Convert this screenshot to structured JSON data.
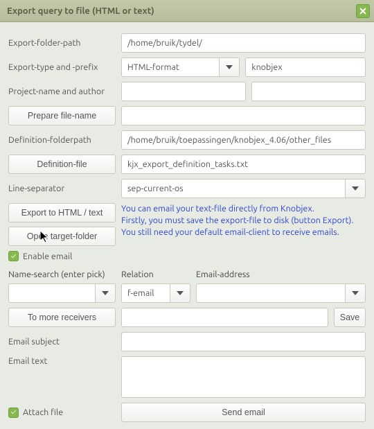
{
  "window": {
    "title": "Export query to file (HTML or text)"
  },
  "labels": {
    "export_folder_path": "Export-folder-path",
    "export_type_prefix": "Export-type and -prefix",
    "project_name_author": "Project-name and author",
    "definition_folderpath": "Definition-folderpath",
    "line_separator": "Line-separator",
    "name_search": "Name-search (enter  pick)",
    "relation": "Relation",
    "email_address": "Email-address",
    "email_subject": "Email subject",
    "email_text": "Email text"
  },
  "buttons": {
    "prepare_filename": "Prepare file-name",
    "definition_file": "Definition-file",
    "export_html_text": "Export to HTML / text",
    "open_target_folder": "Open target-folder",
    "to_more_receivers": "To more receivers",
    "save": "Save",
    "send_email": "Send email"
  },
  "checkboxes": {
    "enable_email": "Enable email",
    "attach_file": "Attach file"
  },
  "values": {
    "export_folder_path": "/home/bruik/tydel/",
    "export_type": "HTML-format",
    "export_prefix": "knobjex",
    "project_name": "",
    "author": "",
    "file_name": "",
    "definition_folderpath": "/home/bruik/toepassingen/knobjex_4.06/other_files",
    "definition_file": "kjx_export_definition_tasks.txt",
    "line_separator": "sep-current-os",
    "name_search": "",
    "relation": "f-email",
    "email_address": "",
    "to_more_receivers": "",
    "email_subject": "",
    "email_text": ""
  },
  "hint": {
    "l1": "You can email your text-file directly from Knobjex.",
    "l2": "Firstly, you must save the export-file to disk (button Export).",
    "l3": "You still need your default email-client to receive emails."
  }
}
